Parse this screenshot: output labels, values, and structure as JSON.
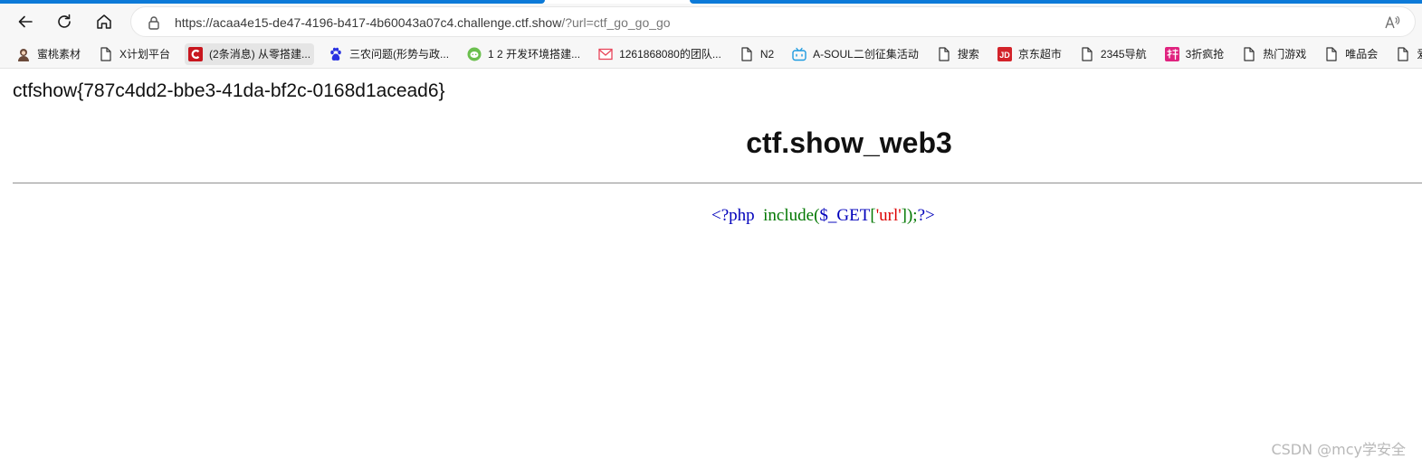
{
  "browser": {
    "url_main": "https://acaa4e15-de47-4196-b417-4b60043a07c4.challenge.ctf.show",
    "url_query": "/?url=ctf_go_go_go",
    "accent_color": "#0c7ad8"
  },
  "bookmarks": [
    {
      "label": "蜜桃素材",
      "icon": "avatar-icon",
      "color": "#6b4a3a"
    },
    {
      "label": "X计划平台",
      "icon": "page-icon",
      "color": "#333333"
    },
    {
      "label": "(2条消息) 从零搭建...",
      "icon": "csdn-icon",
      "color": "#c8161e"
    },
    {
      "label": "三农问题(形势与政...",
      "icon": "baidu-paw-icon",
      "color": "#2932e1"
    },
    {
      "label": "1 2 开发环境搭建...",
      "icon": "wechat-round-icon",
      "color": "#6bbf4e"
    },
    {
      "label": "1261868080的团队...",
      "icon": "mail-icon",
      "color": "#e8455a"
    },
    {
      "label": "N2",
      "icon": "page-icon",
      "color": "#333333"
    },
    {
      "label": "A-SOUL二创征集活动",
      "icon": "bilibili-tv-icon",
      "color": "#1e9be0"
    },
    {
      "label": "搜索",
      "icon": "page-icon",
      "color": "#333333"
    },
    {
      "label": "京东超市",
      "icon": "jd-icon",
      "color": "#d3232a"
    },
    {
      "label": "2345导航",
      "icon": "page-icon",
      "color": "#333333"
    },
    {
      "label": "3折疯抢",
      "icon": "te-icon",
      "color": "#e0237f"
    },
    {
      "label": "热门游戏",
      "icon": "page-icon",
      "color": "#333333"
    },
    {
      "label": "唯品会",
      "icon": "page-icon",
      "color": "#333333"
    },
    {
      "label": "爱淘宝",
      "icon": "page-icon",
      "color": "#333333"
    }
  ],
  "content": {
    "flag": "ctfshow{787c4dd2-bbe3-41da-bf2c-0168d1acead6}",
    "title": "ctf.show_web3",
    "code": {
      "open_tag": "<?php",
      "func": "include(",
      "var": "$_GET",
      "bracket_open": "[",
      "key": "'url'",
      "bracket_close": "]",
      "tail": ");",
      "close_tag": "?>"
    }
  },
  "watermark": "CSDN @mcy学安全"
}
